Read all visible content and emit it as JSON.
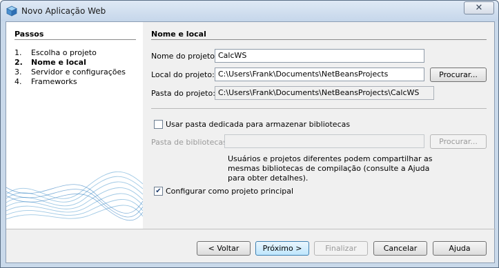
{
  "window": {
    "title": "Novo Aplicação Web",
    "close_glyph": "✕"
  },
  "steps": {
    "title": "Passos",
    "items": [
      {
        "num": "1.",
        "label": "Escolha o projeto"
      },
      {
        "num": "2.",
        "label": "Nome e local"
      },
      {
        "num": "3.",
        "label": "Servidor e configurações"
      },
      {
        "num": "4.",
        "label": "Frameworks"
      }
    ],
    "current_index": 1
  },
  "form": {
    "section_title": "Nome e local",
    "project_name_label": "Nome do projeto:",
    "project_name_value": "CalcWS",
    "project_location_label": "Local do projeto:",
    "project_location_value": "C:\\Users\\Frank\\Documents\\NetBeansProjects",
    "browse_label": "Procurar...",
    "project_folder_label": "Pasta do projeto:",
    "project_folder_value": "C:\\Users\\Frank\\Documents\\NetBeansProjects\\CalcWS",
    "dedicated_folder_label": "Usar pasta dedicada para armazenar bibliotecas",
    "dedicated_folder_checked": false,
    "libraries_folder_label": "Pasta de bibliotecas:",
    "libraries_folder_value": "",
    "libraries_browse_label": "Procurar...",
    "libraries_help": "Usuários e projetos diferentes podem compartilhar as mesmas bibliotecas de compilação (consulte a Ajuda para obter detalhes).",
    "main_project_label": "Configurar como projeto principal",
    "main_project_checked": true,
    "checkmark": "✔"
  },
  "buttons": {
    "back": "< Voltar",
    "next": "Próximo >",
    "finish": "Finalizar",
    "cancel": "Cancelar",
    "help": "Ajuda"
  }
}
